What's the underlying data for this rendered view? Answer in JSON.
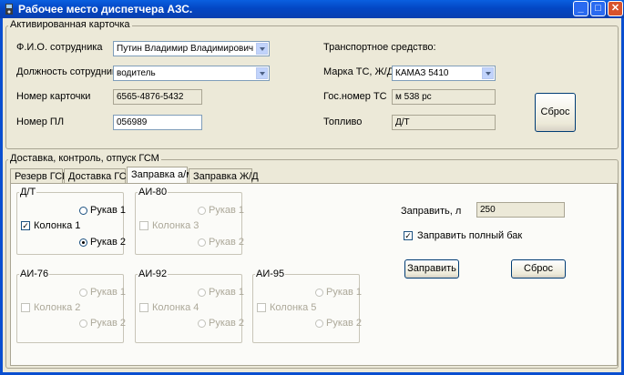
{
  "window": {
    "title": "Рабочее место диспетчера АЗС."
  },
  "card": {
    "group_title": "Активированная карточка",
    "fio_label": "Ф.И.О. сотрудника",
    "fio_value": "Путин Владимир Владимирович",
    "position_label": "Должность сотрудника",
    "position_value": "водитель",
    "card_no_label": "Номер карточки",
    "card_no_value": "6565-4876-5432",
    "pl_label": "Номер ПЛ",
    "pl_value": "056989",
    "vehicle_label": "Транспортное средство:",
    "make_label": "Марка ТС, Ж/Д",
    "make_value": "КАМАЗ 5410",
    "plate_label": "Гос.номер ТС",
    "plate_value": "м 538 рс",
    "fuel_label": "Топливо",
    "fuel_value": "Д/Т",
    "reset_label": "Сброс"
  },
  "delivery": {
    "group_title": "Доставка, контроль, отпуск ГСМ",
    "tabs": [
      "Резерв ГСМ",
      "Доставка ГСМ",
      "Заправка а/м",
      "Заправка Ж/Д"
    ],
    "active_tab": 2
  },
  "fuel_groups": [
    {
      "title": "Д/Т",
      "column": "Колонка 1",
      "hose1": "Рукав 1",
      "hose2": "Рукав 2",
      "enabled": true
    },
    {
      "title": "АИ-80",
      "column": "Колонка 3",
      "hose1": "Рукав 1",
      "hose2": "Рукав 2",
      "enabled": false
    },
    {
      "title": "АИ-76",
      "column": "Колонка 2",
      "hose1": "Рукав 1",
      "hose2": "Рукав 2",
      "enabled": false
    },
    {
      "title": "АИ-92",
      "column": "Колонка 4",
      "hose1": "Рукав 1",
      "hose2": "Рукав 2",
      "enabled": false
    },
    {
      "title": "АИ-95",
      "column": "Колонка 5",
      "hose1": "Рукав 1",
      "hose2": "Рукав 2",
      "enabled": false
    }
  ],
  "refuel": {
    "amount_label": "Заправить, л",
    "amount_value": "250",
    "full_tank_label": "Заправить полный бак",
    "refuel_button": "Заправить",
    "reset_button": "Сброс"
  },
  "colors": {
    "titlebar": "#0a5fe0",
    "window_bg": "#ece9d8",
    "panel_bg": "#fbfbf8"
  }
}
